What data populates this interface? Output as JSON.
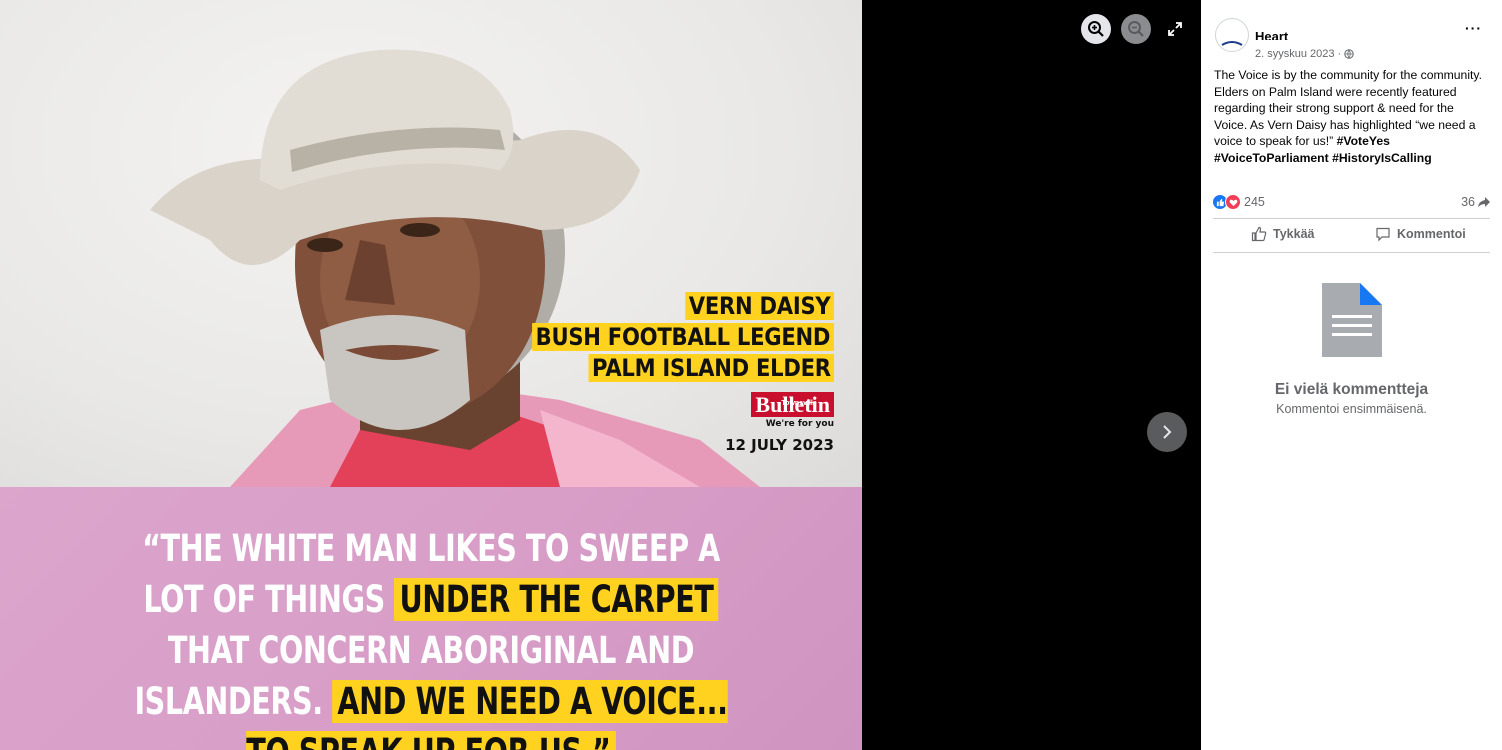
{
  "poster": {
    "caption_lines": [
      "VERN DAISY",
      "BUSH FOOTBALL LEGEND",
      "PALM ISLAND ELDER"
    ],
    "logo_small": "Townsville",
    "logo_main": "Bulletin",
    "logo_tag": "We're for you",
    "date": "12 JULY 2023",
    "quote_parts": [
      "“THE WHITE MAN LIKES TO SWEEP A LOT OF THINGS ",
      "UNDER THE CARPET",
      " THAT CONCERN ABORIGINAL AND ISLANDERS. ",
      "AND WE NEED A VOICE... TO SPEAK UP FOR US.”"
    ]
  },
  "colors": {
    "highlight": "#ffd21f",
    "quote_panel": "#d89ec8",
    "logo_red": "#c8102e",
    "fb_blue": "#1877f2",
    "secondary_text": "#65676b"
  },
  "post": {
    "page_name": "Heart",
    "date": "2. syyskuu 2023 ·",
    "body": "The Voice is by the community for the community. Elders on Palm Island were recently featured regarding their strong support & need for the Voice. As Vern Daisy has highlighted “we need a voice to speak for us!” ",
    "hashtags": "#VoteYes #VoiceToParliament #HistoryIsCalling",
    "reaction_count": "245",
    "share_count": "36",
    "like_label": "Tykkää",
    "comment_label": "Kommentoi",
    "empty_title": "Ei vielä kommentteja",
    "empty_sub": "Kommentoi ensimmäisenä.",
    "more_label": "···"
  },
  "icons": {
    "zoom_in": "zoom-in-icon",
    "zoom_out": "zoom-out-icon",
    "expand": "expand-icon",
    "next": "chevron-right-icon",
    "globe": "globe-icon",
    "like": "thumbs-up-icon",
    "comment": "comment-icon",
    "share": "share-icon",
    "document": "document-icon"
  }
}
